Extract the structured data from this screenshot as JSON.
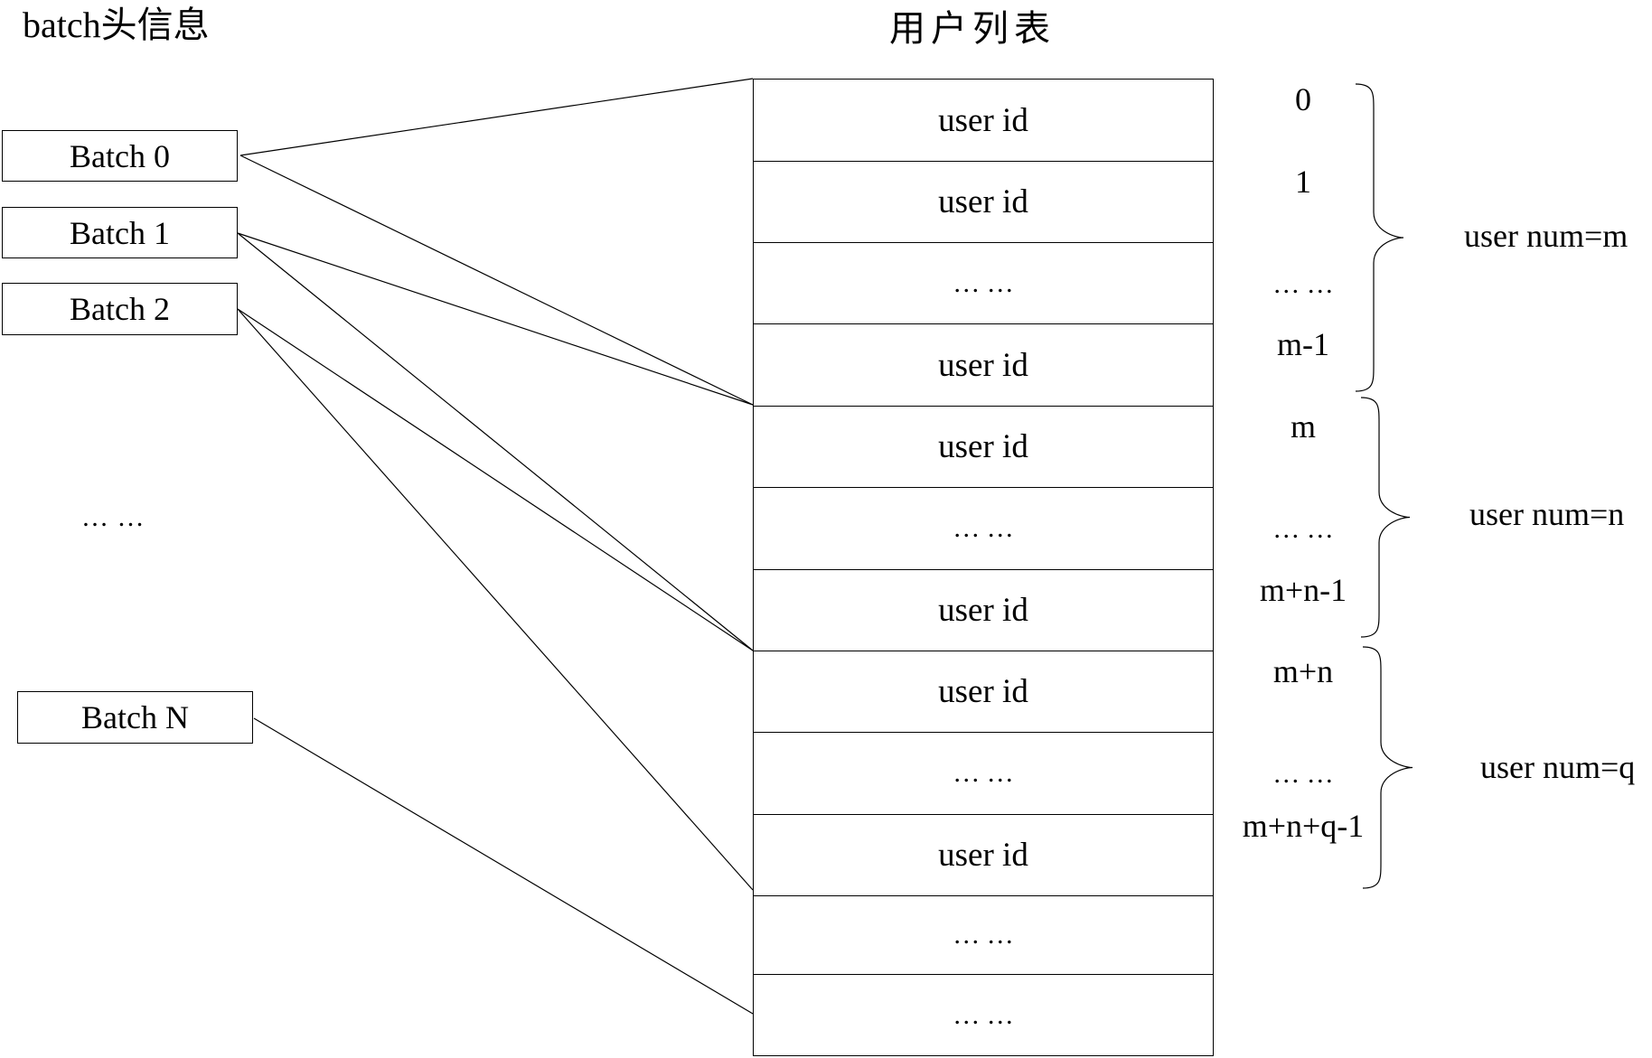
{
  "titles": {
    "batch_header": "batch头信息",
    "user_list": "用户列表"
  },
  "batches": [
    {
      "label": "Batch 0",
      "maps_to_rows": [
        0,
        4
      ]
    },
    {
      "label": "Batch 1",
      "maps_to_rows": [
        4,
        7
      ]
    },
    {
      "label": "Batch 2",
      "maps_to_rows": [
        7,
        10
      ]
    },
    {
      "label": "Batch N",
      "maps_to_rows": [
        12
      ]
    }
  ],
  "batch_ellipsis": "… …",
  "user_rows": [
    {
      "text": "user id",
      "index": "0"
    },
    {
      "text": "user id",
      "index": "1"
    },
    {
      "text": "… …",
      "index": "… …"
    },
    {
      "text": "user id",
      "index": "m-1"
    },
    {
      "text": "user id",
      "index": "m"
    },
    {
      "text": "… …",
      "index": "… …"
    },
    {
      "text": "user id",
      "index": "m+n-1"
    },
    {
      "text": "user id",
      "index": "m+n"
    },
    {
      "text": "… …",
      "index": "… …"
    },
    {
      "text": "user id",
      "index": "m+n+q-1"
    },
    {
      "text": "… …",
      "index": ""
    },
    {
      "text": "… …",
      "index": ""
    }
  ],
  "groups": [
    {
      "label": "user num=m",
      "rows": [
        0,
        3
      ]
    },
    {
      "label": "user num=n",
      "rows": [
        4,
        6
      ]
    },
    {
      "label": "user num=q",
      "rows": [
        7,
        9
      ]
    }
  ]
}
